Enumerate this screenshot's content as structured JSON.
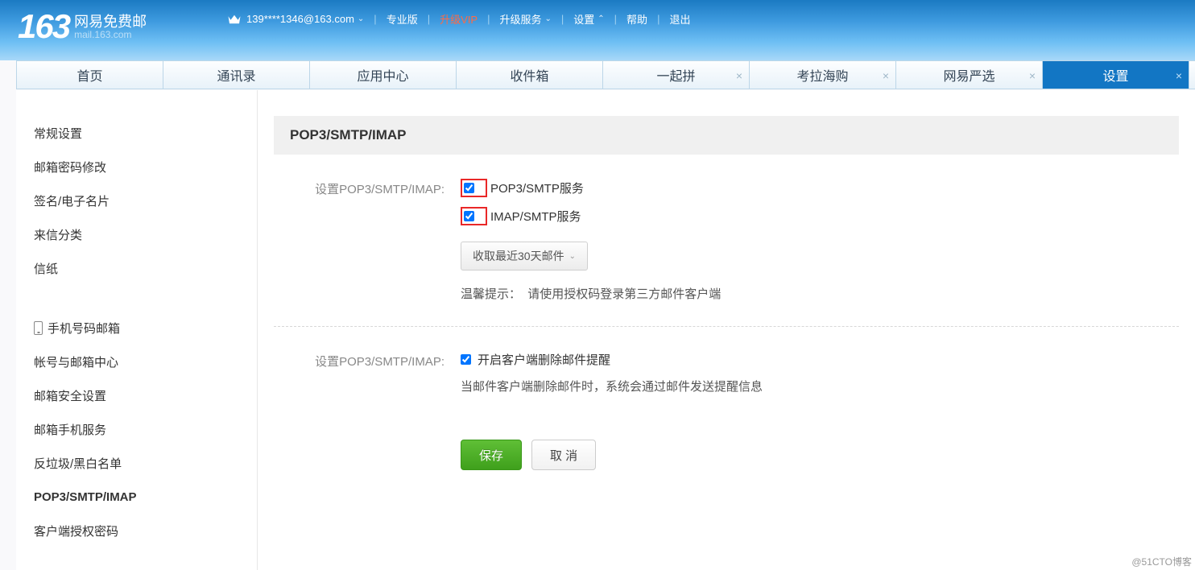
{
  "header": {
    "logo_num": "163",
    "logo_cn": "网易免费邮",
    "logo_en": "mail.163.com",
    "email": "139****1346@163.com",
    "links": {
      "pro": "专业版",
      "vip": "升级VIP",
      "upgrade": "升级服务",
      "settings": "设置",
      "help": "帮助",
      "logout": "退出"
    }
  },
  "tabs": [
    {
      "label": "首页",
      "closable": false
    },
    {
      "label": "通讯录",
      "closable": false
    },
    {
      "label": "应用中心",
      "closable": false
    },
    {
      "label": "收件箱",
      "closable": false
    },
    {
      "label": "一起拼",
      "closable": true
    },
    {
      "label": "考拉海购",
      "closable": true
    },
    {
      "label": "网易严选",
      "closable": true
    },
    {
      "label": "设置",
      "closable": true,
      "active": true
    }
  ],
  "sidebar": {
    "group1": [
      "常规设置",
      "邮箱密码修改",
      "签名/电子名片",
      "来信分类",
      "信纸"
    ],
    "group2": [
      {
        "label": "手机号码邮箱",
        "phone": true
      },
      {
        "label": "帐号与邮箱中心"
      },
      {
        "label": "邮箱安全设置"
      },
      {
        "label": "邮箱手机服务"
      },
      {
        "label": "反垃圾/黑白名单"
      },
      {
        "label": "POP3/SMTP/IMAP",
        "active": true
      },
      {
        "label": "客户端授权密码"
      }
    ]
  },
  "panel": {
    "title": "POP3/SMTP/IMAP",
    "section1": {
      "label": "设置POP3/SMTP/IMAP:",
      "chk_pop3": "POP3/SMTP服务",
      "chk_imap": "IMAP/SMTP服务",
      "range_select": "收取最近30天邮件",
      "tip_label": "温馨提示：",
      "tip_text": "请使用授权码登录第三方邮件客户端"
    },
    "section2": {
      "label": "设置POP3/SMTP/IMAP:",
      "chk_delete": "开启客户端删除邮件提醒",
      "desc": "当邮件客户端删除邮件时，系统会通过邮件发送提醒信息"
    },
    "btn_save": "保存",
    "btn_cancel": "取 消"
  },
  "watermark": "@51CTO博客"
}
